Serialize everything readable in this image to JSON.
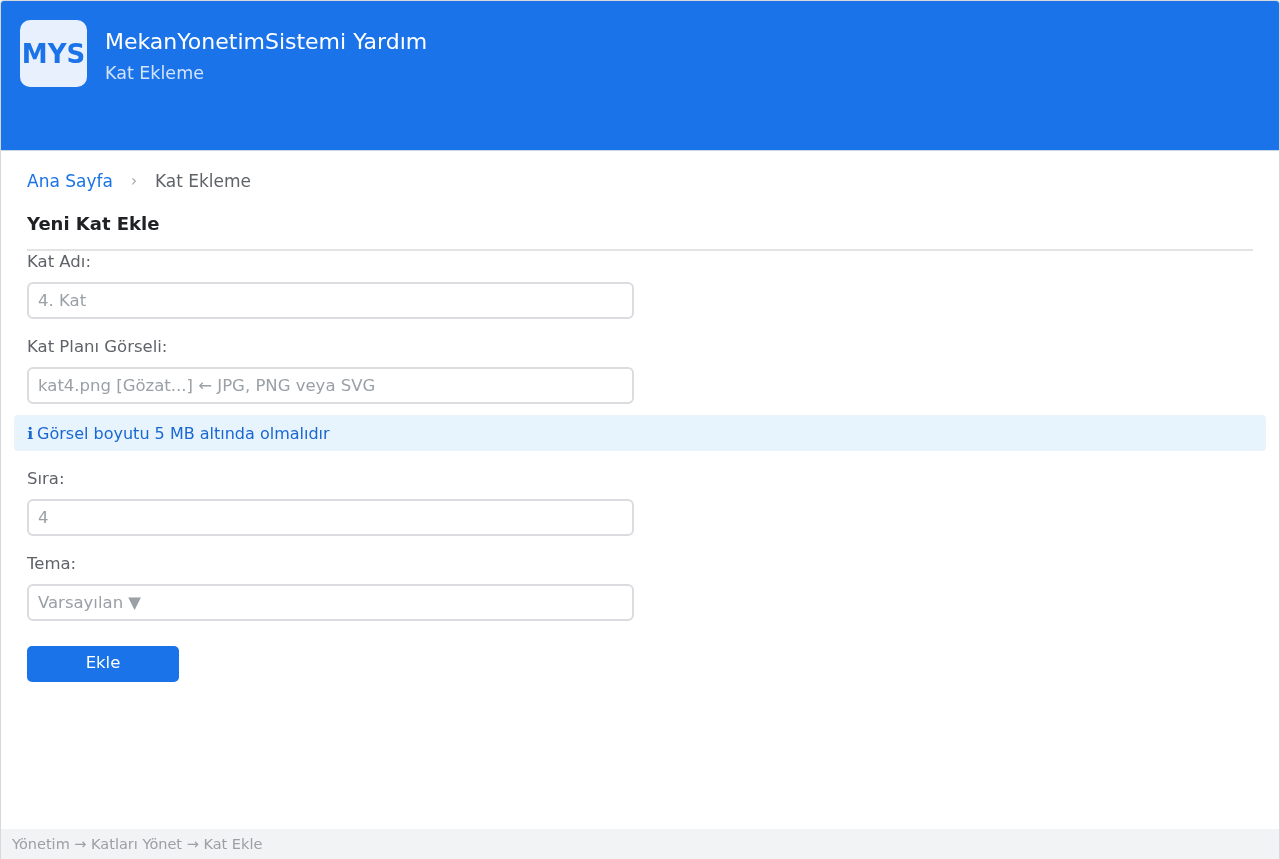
{
  "header": {
    "logo": "MYS",
    "title": "MekanYonetimSistemi Yardım",
    "subtitle": "Kat Ekleme"
  },
  "breadcrumb": {
    "separator": "›",
    "items": [
      {
        "label": "Ana Sayfa",
        "kind": "link"
      },
      {
        "label": "Kat Ekleme",
        "kind": "current"
      }
    ]
  },
  "form": {
    "heading": "Yeni Kat Ekle",
    "items": [
      {
        "kind": "input",
        "label": "Kat Adı:",
        "placeholder": "4. Kat"
      },
      {
        "kind": "file",
        "label": "Kat Planı Görseli:",
        "placeholder": "kat4.png [Gözat...] ← JPG, PNG veya SVG"
      },
      {
        "kind": "notice",
        "icon": "ℹ",
        "text": "Görsel boyutu 5 MB altında olmalıdır"
      },
      {
        "kind": "input",
        "label": "Sıra:",
        "placeholder": "4"
      },
      {
        "kind": "select",
        "label": "Tema:",
        "placeholder": "Varsayılan ▼"
      }
    ],
    "submit": "Ekle"
  },
  "status_bar": "Yönetim → Katları Yönet → Kat Ekle"
}
